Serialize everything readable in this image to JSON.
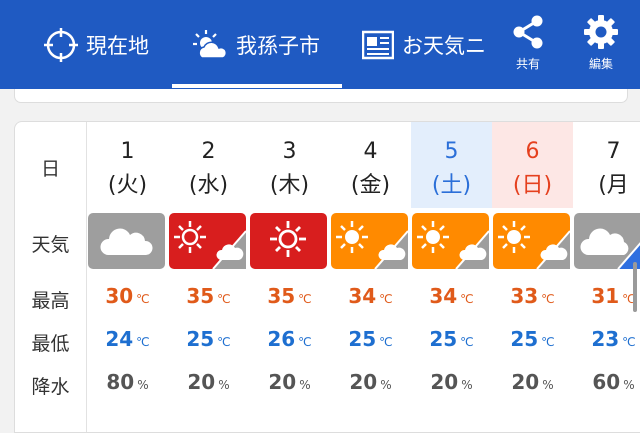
{
  "header": {
    "tabs": [
      {
        "label": "現在地",
        "icon": "crosshair-icon"
      },
      {
        "label": "我孫子市",
        "icon": "partly-cloudy-icon"
      },
      {
        "label": "お天気ニ",
        "icon": "news-icon"
      }
    ],
    "share_label": "共有",
    "edit_label": "編集"
  },
  "row_labels": {
    "day": "日",
    "weather": "天気",
    "high": "最高",
    "low": "最低",
    "precip": "降水"
  },
  "units": {
    "temp": "℃",
    "precip": "%"
  },
  "days": [
    {
      "num": "1",
      "weekday": "(火)",
      "weather": "cloudy",
      "high": "30",
      "low": "24",
      "precip": "80"
    },
    {
      "num": "2",
      "weekday": "(水)",
      "weather": "sunny-cloudy-hot",
      "high": "35",
      "low": "25",
      "precip": "20"
    },
    {
      "num": "3",
      "weekday": "(木)",
      "weather": "sunny-hot",
      "high": "35",
      "low": "26",
      "precip": "20"
    },
    {
      "num": "4",
      "weekday": "(金)",
      "weather": "sunny-cloudy",
      "high": "34",
      "low": "25",
      "precip": "20"
    },
    {
      "num": "5",
      "weekday": "(土)",
      "weather": "sunny-cloudy",
      "high": "34",
      "low": "25",
      "precip": "20"
    },
    {
      "num": "6",
      "weekday": "(日)",
      "weather": "sunny-cloudy",
      "high": "33",
      "low": "25",
      "precip": "20"
    },
    {
      "num": "7",
      "weekday": "(月",
      "weather": "cloudy-rain",
      "high": "31",
      "low": "23",
      "precip": "60"
    }
  ],
  "colors": {
    "header": "#1f5ac2",
    "hot": "#d81e1e",
    "sunny": "#ff8a00",
    "cloudy": "#9e9e9e",
    "saturday": "#2b6fd8",
    "sunday": "#e5401e",
    "high": "#e05a1a",
    "low": "#1e6fd0"
  }
}
